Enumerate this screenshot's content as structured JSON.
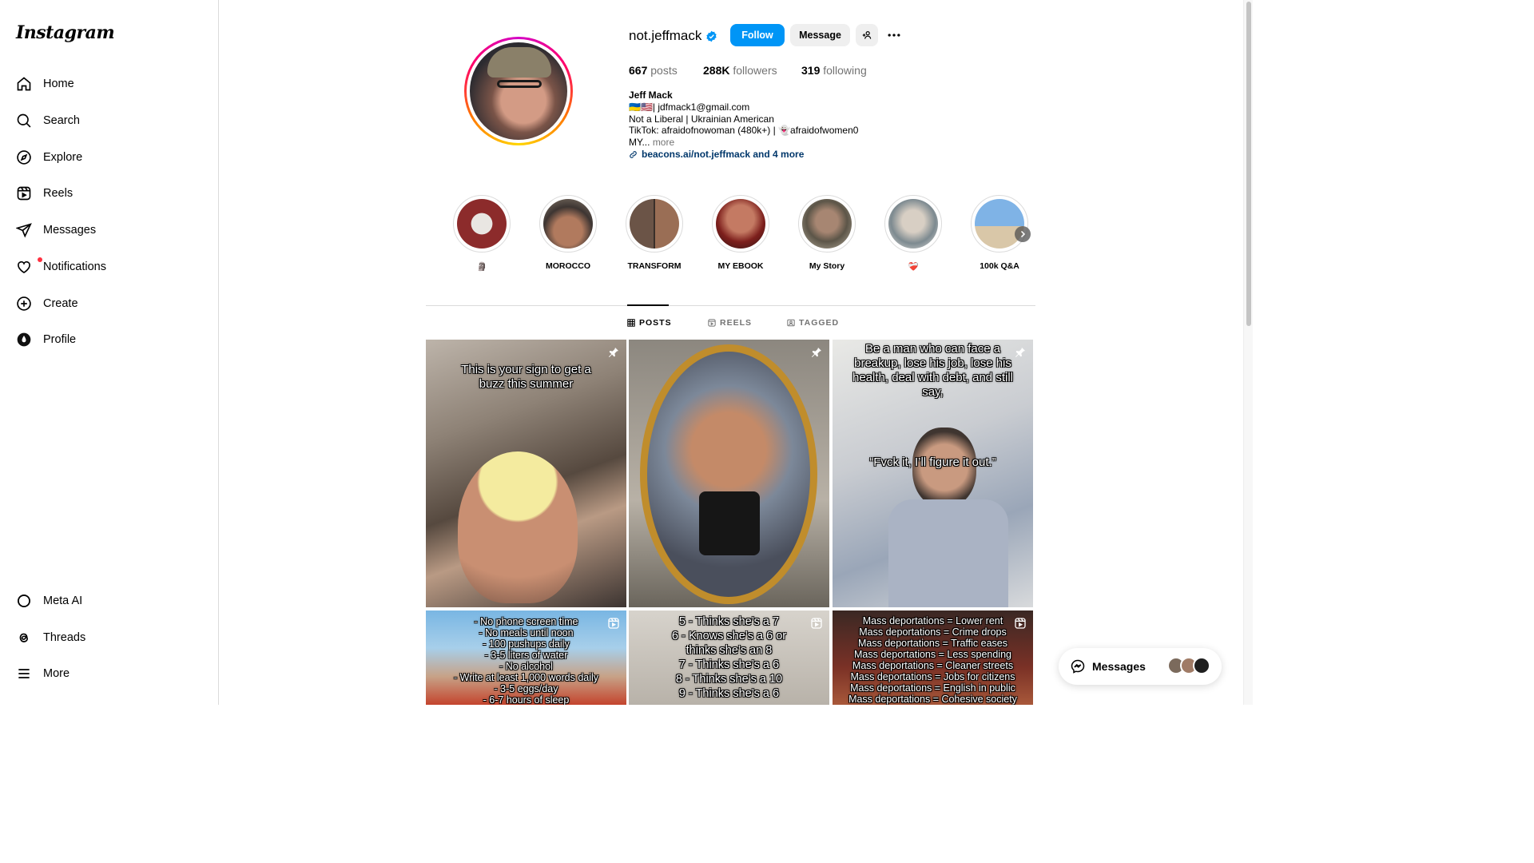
{
  "app": {
    "logo_text": "Instagram"
  },
  "sidebar": {
    "items": [
      {
        "label": "Home",
        "icon": "home-icon"
      },
      {
        "label": "Search",
        "icon": "search-icon"
      },
      {
        "label": "Explore",
        "icon": "compass-icon"
      },
      {
        "label": "Reels",
        "icon": "reels-icon"
      },
      {
        "label": "Messages",
        "icon": "send-icon"
      },
      {
        "label": "Notifications",
        "icon": "heart-icon"
      },
      {
        "label": "Create",
        "icon": "plus-square-icon"
      },
      {
        "label": "Profile",
        "icon": "profile-avatar-icon"
      }
    ],
    "bottom_items": [
      {
        "label": "Meta AI",
        "icon": "meta-ai-icon"
      },
      {
        "label": "Threads",
        "icon": "threads-icon"
      },
      {
        "label": "More",
        "icon": "menu-icon"
      }
    ]
  },
  "profile": {
    "username": "not.jeffmack",
    "follow_label": "Follow",
    "message_label": "Message",
    "stats": {
      "posts_value": "667",
      "posts_label": "posts",
      "followers_value": "288K",
      "followers_label": "followers",
      "following_value": "319",
      "following_label": "following"
    },
    "bio": {
      "name": "Jeff Mack",
      "line1": "🇺🇦🇺🇸| jdfmack1@gmail.com",
      "line2": "Not a Liberal | Ukrainian American",
      "line3": "TikTok: afraidofnowoman (480k+) | 👻afraidofwomen0",
      "line4": "MY...",
      "more": "more",
      "link": "beacons.ai/not.jeffmack and 4 more"
    }
  },
  "highlights": [
    {
      "label": "🗿"
    },
    {
      "label": "MOROCCO"
    },
    {
      "label": "TRANSFORM"
    },
    {
      "label": "MY EBOOK"
    },
    {
      "label": "My Story"
    },
    {
      "label": "❤️‍🩹"
    },
    {
      "label": "100k Q&A"
    }
  ],
  "tabs": [
    {
      "label": "POSTS"
    },
    {
      "label": "REELS"
    },
    {
      "label": "TAGGED"
    }
  ],
  "posts": [
    {
      "caption": "This is your sign to get a buzz this summer"
    },
    {
      "caption": ""
    },
    {
      "caption": "Be a man who can face a breakup, lose his job, lose his health, deal with debt, and still say,",
      "caption2": "“Fvck it, I’ll figure it out.”"
    },
    {
      "caption": "- No phone screen time\n- No meals until noon\n- 100 pushups daily\n- 3-5 liters of water\n- No alcohol\n- Write at least 1,000 words daily\n- 3-5 eggs/day\n- 6-7 hours of sleep"
    },
    {
      "caption": "5 - Thinks she’s a 7\n6 - Knows she’s a 6 or thinks she’s an 8\n7 - Thinks she’s a 6\n8 - Thinks she’s a 10\n9 - Thinks she’s a 6"
    },
    {
      "caption": "Mass deportations = Lower rent\nMass deportations = Crime drops\nMass deportations = Traffic eases\nMass deportations = Less spending\nMass deportations = Cleaner streets\nMass deportations = Jobs for citizens\nMass deportations = English in public\nMass deportations = Cohesive society"
    }
  ],
  "messages_float": {
    "label": "Messages"
  },
  "colors": {
    "accent": "#0095f6",
    "link": "#00376b",
    "muted": "#737373"
  }
}
